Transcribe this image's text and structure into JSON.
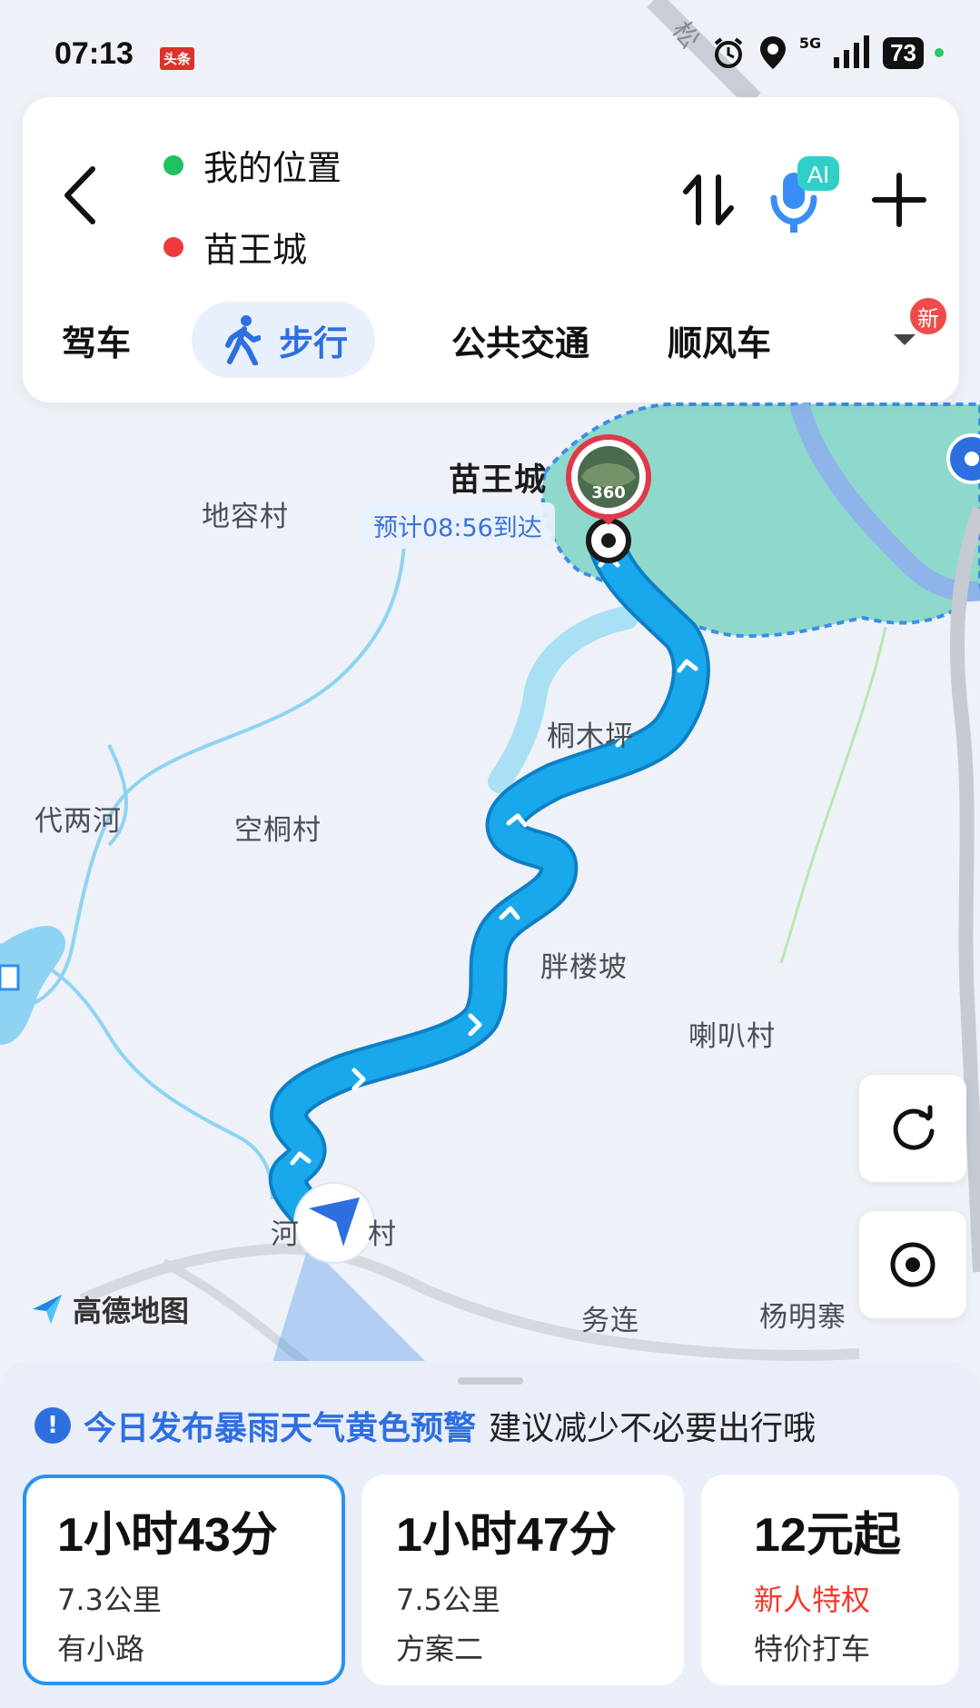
{
  "status_bar": {
    "time": "07:13",
    "app_badge": "头条",
    "network": "5G",
    "battery": "73"
  },
  "route": {
    "origin": "我的位置",
    "destination": "苗王城",
    "origin_color": "#1fc160",
    "destination_color": "#ef3b3b",
    "ai_label": "AI"
  },
  "tabs": [
    {
      "label": "驾车"
    },
    {
      "label": "步行",
      "active": true
    },
    {
      "label": "公共交通"
    },
    {
      "label": "顺风车"
    }
  ],
  "new_badge": "新",
  "map": {
    "destination_label": "苗王城",
    "panorama_label": "360",
    "eta": "预计08:56到达",
    "places": [
      "地容村",
      "代两河",
      "空桐村",
      "桐木坪",
      "胖楼坡",
      "喇叭村",
      "河",
      "村",
      "务连",
      "杨明寨"
    ],
    "road_label": "松",
    "brand": "高德地图",
    "route_color": "#19a8ec"
  },
  "warning": {
    "main": "今日发布暴雨天气黄色预警",
    "sub": "建议减少不必要出行哦"
  },
  "options": [
    {
      "duration": "1小时43分",
      "distance": "7.3公里",
      "note": "有小路",
      "selected": true
    },
    {
      "duration": "1小时47分",
      "distance": "7.5公里",
      "note": "方案二"
    },
    {
      "price": "12元起",
      "promo": "新人特权",
      "note": "特价打车"
    }
  ]
}
